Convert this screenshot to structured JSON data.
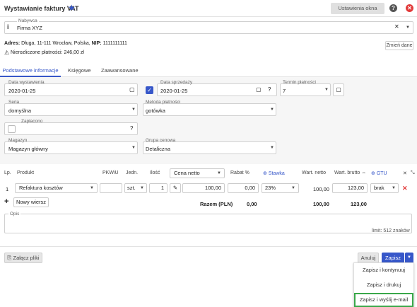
{
  "header": {
    "title": "Wystawianie faktury VAT",
    "settings_label": "Ustawienia okna",
    "help": "?",
    "close": "✕"
  },
  "buyer": {
    "label": "Nabywca",
    "value": "Firma XYZ",
    "address_prefix": "Adres:",
    "address": "Długa, 11-111 Wrocław, Polska,",
    "nip_prefix": "NIP:",
    "nip": "1111111111",
    "unpaid": "Nierozliczone płatności: 246,00 zł",
    "change_label": "Zmień dane"
  },
  "tabs": [
    "Podstawowe informacje",
    "Księgowe",
    "Zaawansowane"
  ],
  "form": {
    "issue_date": {
      "label": "Data wystawienia",
      "value": "2020-01-25"
    },
    "sale_date": {
      "label": "Data sprzedaży",
      "value": "2020-01-25",
      "help": "?"
    },
    "payment_term": {
      "label": "Termin płatności",
      "value": "7"
    },
    "series": {
      "label": "Seria",
      "value": "domyślna"
    },
    "payment_method": {
      "label": "Metoda płatności",
      "value": "gotówka"
    },
    "paid": {
      "label": "Zapłacono",
      "help": "?"
    },
    "warehouse": {
      "label": "Magazyn",
      "value": "Magazyn główny"
    },
    "price_group": {
      "label": "Grupa cenowa",
      "value": "Detaliczna"
    }
  },
  "table": {
    "headers": {
      "lp": "Lp.",
      "product": "Produkt",
      "pkwiu": "PKWiU",
      "unit": "Jedn.",
      "qty": "Ilość",
      "price_type": "Cena netto",
      "discount": "Rabat %",
      "vat": "Stawka",
      "net": "Wart. netto",
      "gross": "Wart. brutto",
      "gtu": "GTU"
    },
    "row": {
      "lp": "1",
      "product": "Refaktura kosztów",
      "unit": "szt.",
      "qty": "1",
      "price": "100,00",
      "discount": "0,00",
      "vat": "23%",
      "net": "100,00",
      "gross": "123,00",
      "gtu": "brak"
    },
    "totals": {
      "label": "Razem (PLN)",
      "discount": "0,00",
      "net": "100,00",
      "gross": "123,00"
    },
    "add_row": "Nowy wiersz"
  },
  "notes": {
    "label": "Opis",
    "limit": "limit: 512 znaków"
  },
  "footer": {
    "attach": "Załącz pliki",
    "cancel": "Anuluj",
    "save": "Zapisz"
  },
  "save_menu": [
    "Zapisz i kontynuuj",
    "Zapisz i drukuj",
    "Zapisz i wyślij e-mail"
  ],
  "colors": {
    "accent": "#3757c9",
    "danger": "#e23b3b",
    "highlight": "#3aa84a"
  }
}
